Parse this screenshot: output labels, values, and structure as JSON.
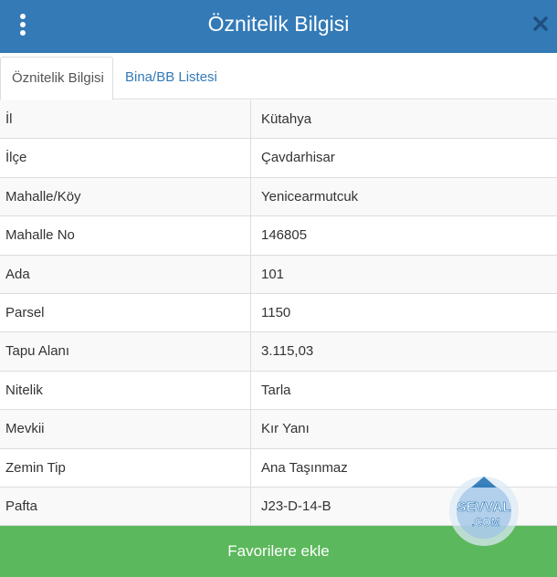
{
  "header": {
    "title": "Öznitelik Bilgisi"
  },
  "tabs": [
    {
      "label": "Öznitelik Bilgisi",
      "active": true
    },
    {
      "label": "Bina/BB Listesi",
      "active": false
    }
  ],
  "attributes": [
    {
      "key": "İl",
      "value": "Kütahya"
    },
    {
      "key": "İlçe",
      "value": "Çavdarhisar"
    },
    {
      "key": "Mahalle/Köy",
      "value": "Yenicearmutcuk"
    },
    {
      "key": "Mahalle No",
      "value": "146805"
    },
    {
      "key": "Ada",
      "value": "101"
    },
    {
      "key": "Parsel",
      "value": "1150"
    },
    {
      "key": "Tapu Alanı",
      "value": "3.115,03"
    },
    {
      "key": "Nitelik",
      "value": "Tarla"
    },
    {
      "key": "Mevkii",
      "value": "Kır Yanı"
    },
    {
      "key": "Zemin Tip",
      "value": "Ana Taşınmaz"
    },
    {
      "key": "Pafta",
      "value": "J23-D-14-B"
    }
  ],
  "footer": {
    "favorite_label": "Favorilere ekle"
  },
  "watermark": {
    "text_line1": "SEVVAL",
    "text_line2": ".COM"
  },
  "colors": {
    "header": "#337ab7",
    "tab_link": "#337ab7",
    "favorite_button": "#5cb85c"
  },
  "icons": {
    "menu": "more-vertical-icon",
    "close": "close-icon"
  }
}
